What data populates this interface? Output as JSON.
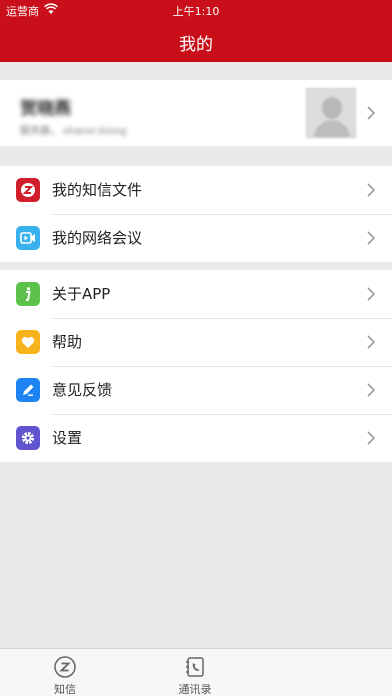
{
  "status_bar": {
    "carrier": "运营商",
    "time": "上午1:10"
  },
  "nav": {
    "title": "我的"
  },
  "profile": {
    "name": "贺晓燕",
    "subtitle": "服务器，  shanxi.kiong"
  },
  "menu_group_1": [
    {
      "label": "我的知信文件",
      "icon": "zhixin-file-icon",
      "color": "#d01e2a"
    },
    {
      "label": "我的网络会议",
      "icon": "video-meeting-icon",
      "color": "#3ab1ef"
    }
  ],
  "menu_group_2": [
    {
      "label": "关于APP",
      "icon": "info-icon",
      "color": "#5cc24b"
    },
    {
      "label": "帮助",
      "icon": "heart-icon",
      "color": "#f6b31c"
    },
    {
      "label": "意见反馈",
      "icon": "pencil-icon",
      "color": "#1c84f0"
    },
    {
      "label": "设置",
      "icon": "gear-icon",
      "color": "#6155cf"
    }
  ],
  "tabbar": {
    "tabs": [
      {
        "label": "知信",
        "icon": "zhixin-tab-icon"
      },
      {
        "label": "通讯录",
        "icon": "contacts-tab-icon"
      }
    ]
  },
  "colors": {
    "header": "#c9101a",
    "background": "#e9e9eb"
  }
}
